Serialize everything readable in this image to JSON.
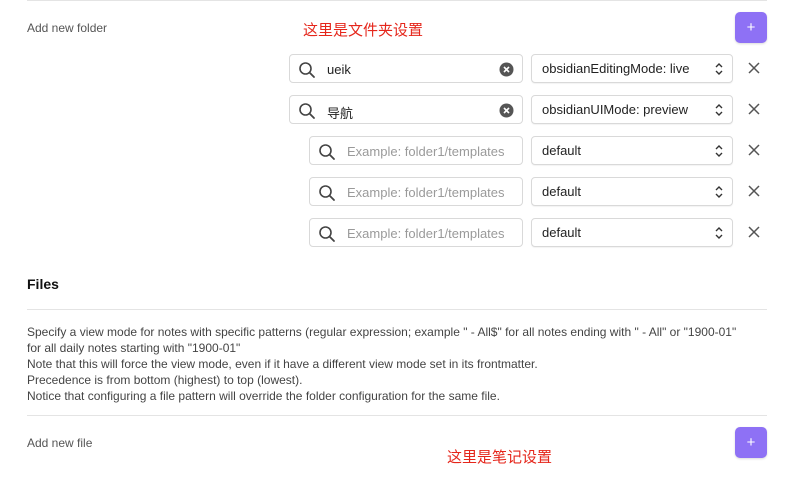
{
  "folders": {
    "add_label": "Add new folder",
    "annotation": "这里是文件夹设置",
    "add_button_icon": "plus-icon",
    "add_button_glyph": "+",
    "rows": [
      {
        "path": "ueik",
        "placeholder": "Example: folder1/templates",
        "mode": "obsidianEditingMode: live"
      },
      {
        "path": "导航",
        "placeholder": "Example: folder1/templates",
        "mode": "obsidianUIMode: preview"
      },
      {
        "path": "",
        "placeholder": "Example: folder1/templates",
        "mode": "default"
      },
      {
        "path": "",
        "placeholder": "Example: folder1/templates",
        "mode": "default"
      },
      {
        "path": "",
        "placeholder": "Example: folder1/templates",
        "mode": "default"
      }
    ]
  },
  "files": {
    "heading": "Files",
    "description": [
      "Specify a view mode for notes with specific patterns (regular expression; example \" - All$\" for all notes ending with \" - All\" or \"1900-01\"",
      "for all daily notes starting with \"1900-01\"",
      "Note that this will force the view mode, even if it have a different view mode set in its frontmatter.",
      "Precedence is from bottom (highest) to top (lowest).",
      "Notice that configuring a file pattern will override the folder configuration for the same file."
    ],
    "add_label": "Add new file",
    "annotation": "这里是笔记设置",
    "add_button_glyph": "+"
  },
  "colors": {
    "accent": "#8e71f5",
    "annotation": "#e5261b"
  }
}
